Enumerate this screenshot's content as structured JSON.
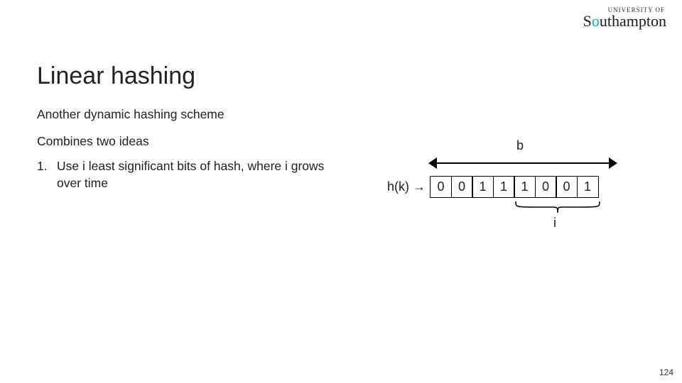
{
  "logo": {
    "small": "UNIVERSITY OF",
    "name_prefix": "S",
    "name_rest": "uthampton"
  },
  "title": "Linear hashing",
  "body": {
    "line1": "Another dynamic hashing scheme",
    "line2": "Combines two ideas",
    "item1_num": "1.",
    "item1_text": "Use i least significant bits of hash, where i grows over time"
  },
  "diagram": {
    "b_label": "b",
    "hk_label": "h(k) →",
    "bits": [
      "0",
      "0",
      "1",
      "1",
      "1",
      "0",
      "0",
      "1"
    ],
    "i_label": "i"
  },
  "slide_number": "124"
}
